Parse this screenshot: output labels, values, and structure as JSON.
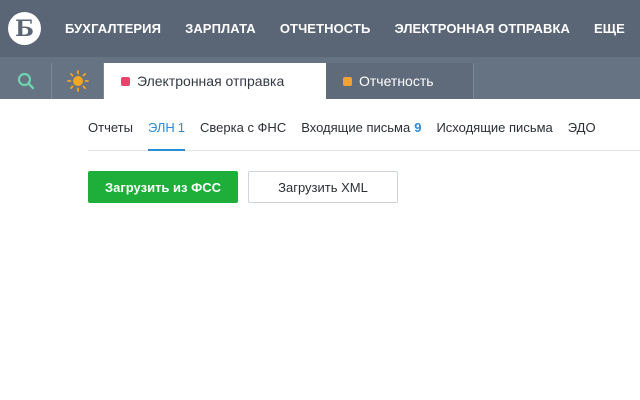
{
  "header": {
    "logo_letter": "Б",
    "nav": [
      "БУХГАЛТЕРИЯ",
      "ЗАРПЛАТА",
      "ОТЧЕТНОСТЬ",
      "ЭЛЕКТРОННАЯ ОТПРАВКА",
      "ЕЩЕ"
    ]
  },
  "toolbar": {
    "search_icon": "search-icon",
    "theme_icon": "sun-icon"
  },
  "tabs": [
    {
      "label": "Электронная отправка",
      "color": "#e8456e",
      "active": true
    },
    {
      "label": "Отчетность",
      "color": "#f0a232",
      "active": false
    }
  ],
  "subtabs": {
    "reports": "Отчеты",
    "eln": "ЭЛН",
    "eln_count": "1",
    "fns": "Сверка с ФНС",
    "incoming": "Входящие письма",
    "incoming_count": "9",
    "outgoing": "Исходящие письма",
    "edo": "ЭДО"
  },
  "actions": {
    "load_fss": "Загрузить из ФСС",
    "load_xml": "Загрузить XML"
  },
  "colors": {
    "header_bg": "#5a6675",
    "accent_blue": "#2a8bd6",
    "primary_green": "#1eaf3a"
  }
}
